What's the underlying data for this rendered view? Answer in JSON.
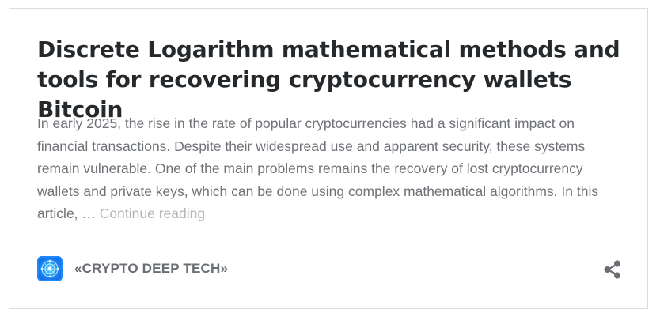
{
  "post": {
    "title": "Discrete Logarithm mathematical methods and tools for recovering cryptocurrency wallets Bitcoin",
    "excerpt": "In early 2025, the rise in the rate of popular cryptocurrencies had a significant impact on financial transactions. Despite their widespread use and apparent security, these systems remain vulnerable. One of the main problems remains the recovery of lost cryptocurrency wallets and private keys, which can be done using complex mathematical algorithms. In this article, … ",
    "continue_label": "Continue reading"
  },
  "footer": {
    "author": "«CRYPTO DEEP TECH»",
    "avatar_icon": "crypto-deep-tech-logo-icon",
    "share_icon": "share-icon"
  },
  "colors": {
    "title": "#26292c",
    "excerpt": "#6f7277",
    "continue": "#b3b6b9",
    "author": "#6a6d71",
    "share": "#6b6e72",
    "avatar": "#1b7df0",
    "border": "#dcdcdc"
  }
}
